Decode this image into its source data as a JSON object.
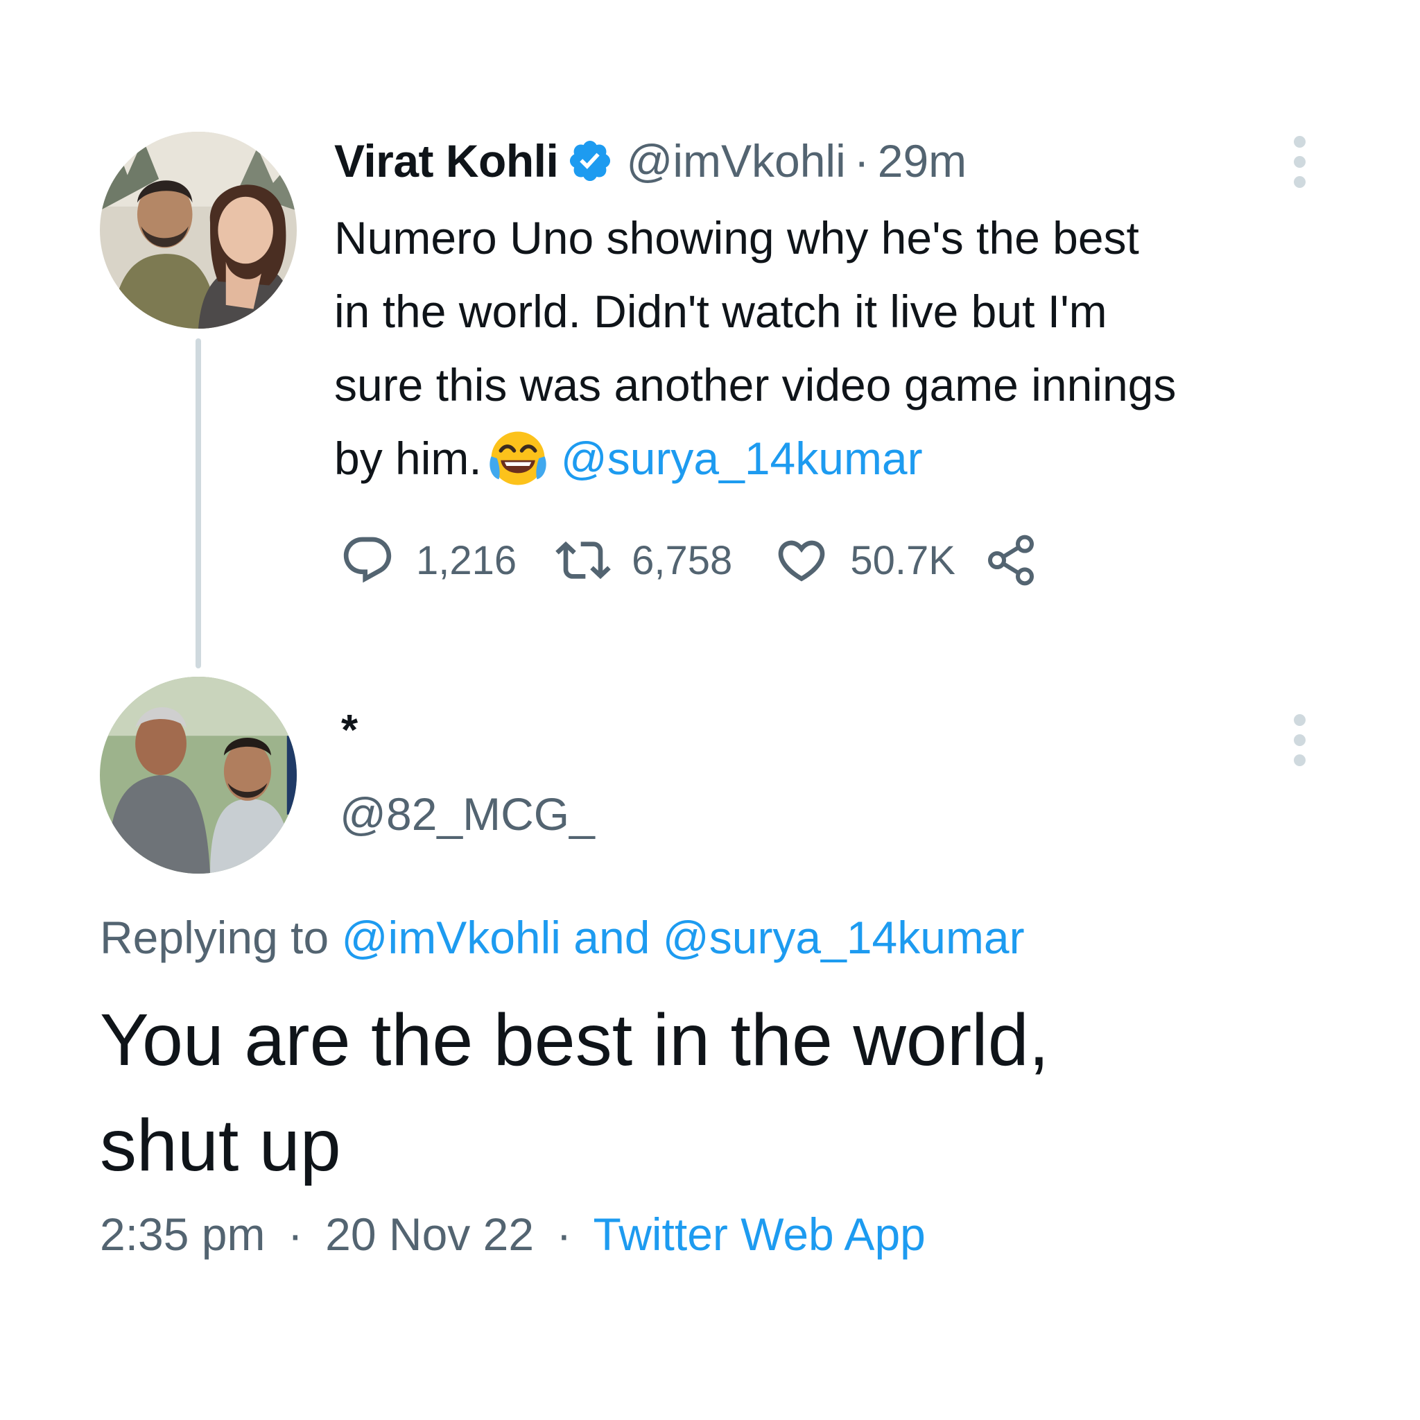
{
  "original_tweet": {
    "author_name": "Virat Kohli",
    "author_handle": "@imVkohli",
    "separator": "·",
    "timestamp": "29m",
    "verified": true,
    "text_lines": [
      "Numero Uno showing why he's the best",
      "in the world. Didn't watch it live but I'm",
      "sure this was another video game innings"
    ],
    "text_last_line_prefix": "by him.",
    "emoji": "face-with-tears-of-joy",
    "mention": "@surya_14kumar",
    "actions": {
      "reply_icon": "reply-icon",
      "reply_count": "1,216",
      "retweet_icon": "retweet-icon",
      "retweet_count": "6,758",
      "like_icon": "heart-icon",
      "like_count": "50.7K",
      "share_icon": "share-icon"
    }
  },
  "reply_tweet": {
    "author_name": "*",
    "author_handle": "@82_MCG_",
    "replying_prefix": "Replying to",
    "replying_mentions": "@imVkohli and @surya_14kumar",
    "text_lines": [
      "You are the best in the world,",
      "shut up"
    ],
    "time": "2:35 pm",
    "separator": "·",
    "date": "20 Nov 22",
    "source": "Twitter Web App"
  },
  "colors": {
    "text": "#0f1419",
    "secondary": "#536471",
    "link": "#1d9bf0",
    "thread_line": "#cfd9de",
    "verified_badge": "#1d9bf0"
  }
}
